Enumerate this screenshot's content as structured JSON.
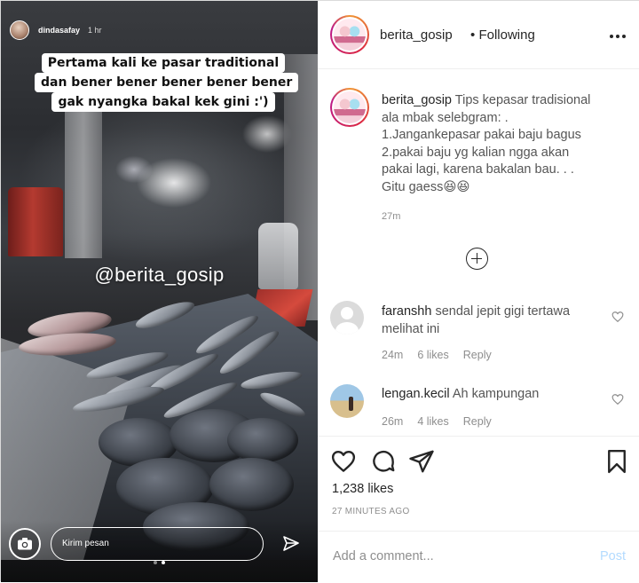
{
  "story": {
    "username": "dindasafay",
    "time": "1 hr",
    "caption_lines": [
      "Pertama kali ke pasar traditional",
      "dan bener bener bener bener bener",
      "gak nyangka bakal kek gini :')"
    ],
    "watermark": "@berita_gosip",
    "message_placeholder": "Kirim pesan"
  },
  "post": {
    "username": "berita_gosip",
    "separator": "•",
    "follow_status": "Following",
    "caption": {
      "username": "berita_gosip",
      "lines": [
        "Tips kepasar tradisional",
        "ala mbak selebgram: .",
        "1.Jangankepasar pakai baju bagus",
        "2.pakai baju yg kalian ngga akan",
        "pakai lagi, karena bakalan bau. . .",
        "Gitu gaess😆😆"
      ],
      "time": "27m"
    },
    "comments": [
      {
        "username": "faranshh",
        "text_line1": "sendal jepit gigi tertawa",
        "text_line2": "melihat ini",
        "time": "24m",
        "likes": "6 likes",
        "reply": "Reply"
      },
      {
        "username": "lengan.kecil",
        "text_line1": "Ah kampungan",
        "text_line2": "",
        "time": "26m",
        "likes": "4 likes",
        "reply": "Reply"
      }
    ],
    "likes": "1,238 likes",
    "posted_ago": "27 MINUTES AGO",
    "add_comment_placeholder": "Add a comment...",
    "post_button": "Post"
  },
  "colors": {
    "text_primary": "#262626",
    "text_secondary": "#8e8e8e",
    "post_disabled": "#b3dbff",
    "border": "#efefef"
  },
  "icons": {
    "more": "more-icon",
    "load_more": "plus-circle-icon",
    "heart": "heart-icon",
    "comment": "comment-icon",
    "share": "share-icon",
    "save": "bookmark-icon",
    "camera": "camera-icon",
    "send": "send-icon"
  }
}
